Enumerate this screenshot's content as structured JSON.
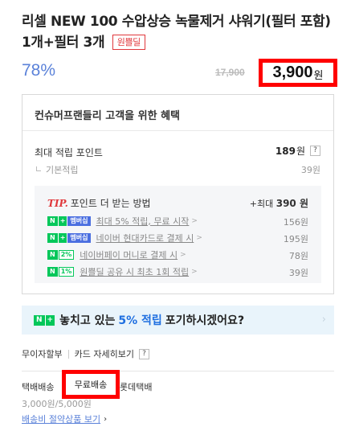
{
  "product": {
    "title": "리셀 NEW 100 수압상승 녹물제거 샤워기(필터 포함) 1개+필터 3개",
    "badge": "원쁠딜",
    "discount": "78%",
    "original_price": "17,900",
    "price": "3,900",
    "price_unit": "원"
  },
  "benefits": {
    "heading": "컨슈머프랜들리 고객을 위한 혜택",
    "max_points_label": "최대 적립 포인트",
    "max_points_value": "189",
    "max_points_unit": "원",
    "help_glyph": "?",
    "basic_label": "기본적립",
    "basic_value": "39원",
    "tip": {
      "tip_word": "TIP.",
      "heading": "포인트 더 받는 방법",
      "max_prefix": "+최대",
      "max_value": "390 원",
      "items": [
        {
          "badge_n": "N",
          "badge_plus": "+",
          "badge_extra": "멤버십",
          "label": "최대 5% 적립, 무료 시작",
          "value": "156원"
        },
        {
          "badge_n": "N",
          "badge_plus": "+",
          "badge_extra": "멤버십",
          "label": "네이버 현대카드로 결제 시",
          "value": "195원"
        },
        {
          "badge_n": "N",
          "badge_plus": "",
          "badge_extra": "2%",
          "label": "네이버페이 머니로 결제 시",
          "value": "78원"
        },
        {
          "badge_n": "N",
          "badge_plus": "",
          "badge_extra": "1%",
          "label": "원쁠딜 공유 시 최초 1회 적립",
          "value": "39원"
        }
      ]
    }
  },
  "banner": {
    "text_before": "놓치고 있는",
    "highlight": "5% 적립",
    "text_after": "포기하시겠어요?",
    "chevron": "›"
  },
  "links": {
    "installment": "무이자할부",
    "card_detail": "카드 자세히보기",
    "help_glyph": "?"
  },
  "shipping": {
    "method_prefix": "택배배송",
    "free_label": "무료배송",
    "carrier_suffix": "롯데택배",
    "fee_text": "3,000원/5,000원",
    "save_link": "배송비 절약상품 보기",
    "chevron": "›"
  },
  "colors": {
    "highlight_border": "#ff0000",
    "discount_blue": "#5b82d9",
    "npay_green": "#03c75a",
    "banner_bg": "#e9f4fb"
  }
}
